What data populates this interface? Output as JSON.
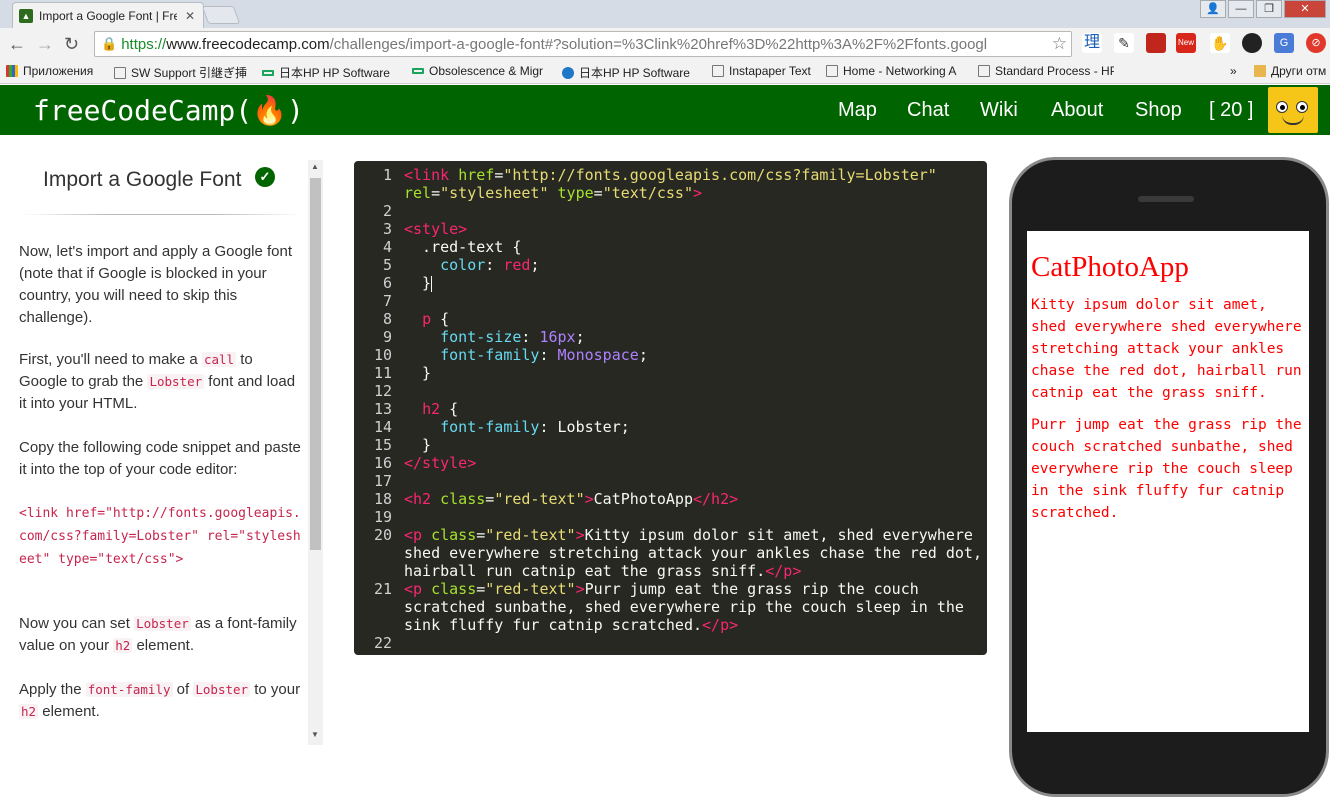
{
  "browser": {
    "tab_title": "Import a Google Font | Fre",
    "url_scheme": "https://",
    "url_host": "www.freecodecamp.com",
    "url_path": "/challenges/import-a-google-font#?solution=%3Clink%20href%3D%22http%3A%2F%2Ffonts.googl",
    "bookmarks": [
      "Приложения",
      "SW Support 引継ぎ挿",
      "日本HP HP Software",
      "Obsolescence & Migr",
      "日本HP HP Software",
      "Instapaper Text",
      "Home - Networking A",
      "Standard Process - HP",
      "Други отм"
    ],
    "bookmark_overflow": "»",
    "ext_new_badge": "New"
  },
  "nav": {
    "logo": "freeCodeCamp(🔥)",
    "links": [
      "Map",
      "Chat",
      "Wiki",
      "About",
      "Shop",
      "[ 20 ]"
    ]
  },
  "challenge": {
    "title": "Import a Google Font",
    "p1": "Now, let's import and apply a Google font (note that if Google is blocked in your country, you will need to skip this challenge).",
    "p2_a": "First, you'll need to make a ",
    "p2_code1": "call",
    "p2_b": " to Google to grab the ",
    "p2_code2": "Lobster",
    "p2_c": " font and load it into your HTML.",
    "p3": "Copy the following code snippet and paste it into the top of your code editor:",
    "snippet": "<link href=\"http://fonts.googleapis.com/css?family=Lobster\" rel=\"stylesheet\" type=\"text/css\">",
    "p4_a": "Now you can set ",
    "p4_code1": "Lobster",
    "p4_b": " as a font-family value on your ",
    "p4_code2": "h2",
    "p4_c": " element.",
    "p5_a": "Apply the ",
    "p5_code1": "font-family",
    "p5_b": " of ",
    "p5_code2": "Lobster",
    "p5_c": " to your ",
    "p5_code3": "h2",
    "p5_d": " element."
  },
  "editor": {
    "line_numbers": [
      "1",
      "2",
      "3",
      "4",
      "5",
      "6",
      "7",
      "8",
      "9",
      "10",
      "11",
      "12",
      "13",
      "14",
      "15",
      "16",
      "17",
      "18",
      "19",
      "20",
      "21",
      "22"
    ]
  },
  "preview": {
    "h2": "CatPhotoApp",
    "p1": "Kitty ipsum dolor sit amet, shed everywhere shed everywhere stretching attack your ankles chase the red dot, hairball run catnip eat the grass sniff.",
    "p2": "Purr jump eat the grass rip the couch scratched sunbathe, shed everywhere rip the couch sleep in the sink fluffy fur catnip scratched."
  }
}
